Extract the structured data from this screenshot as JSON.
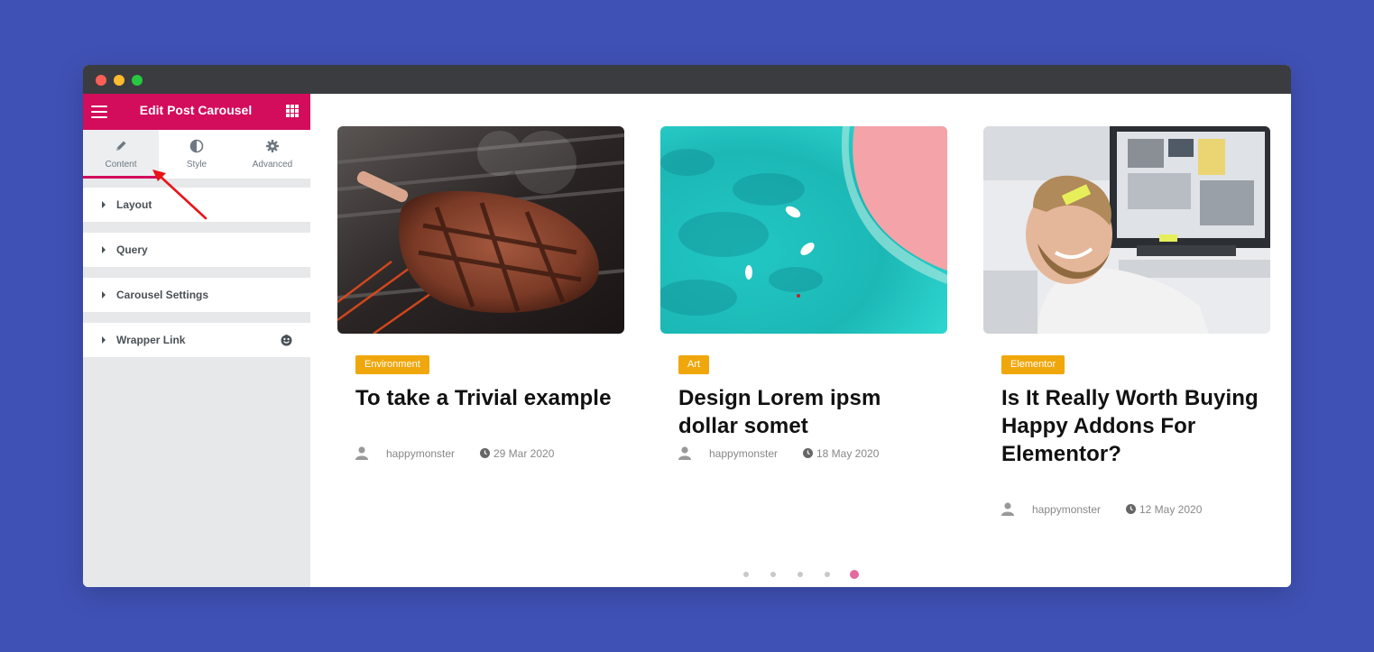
{
  "panel": {
    "title": "Edit Post Carousel",
    "header_color": "#d30c5c",
    "tabs": [
      {
        "label": "Content",
        "icon": "pencil-icon",
        "active": true
      },
      {
        "label": "Style",
        "icon": "contrast-icon",
        "active": false
      },
      {
        "label": "Advanced",
        "icon": "gear-icon",
        "active": false
      }
    ],
    "sections": [
      {
        "label": "Layout"
      },
      {
        "label": "Query"
      },
      {
        "label": "Carousel Settings"
      },
      {
        "label": "Wrapper Link",
        "icon": "happy-addons-icon"
      }
    ]
  },
  "posts": [
    {
      "category": "Environment",
      "title": "To take a Trivial example",
      "author": "happymonster",
      "date": "29 Mar 2020",
      "image": "grilled-steak-photo"
    },
    {
      "category": "Art",
      "title": "Design Lorem ipsm dollar somet",
      "author": "happymonster",
      "date": "18 May 2020",
      "image": "turquoise-sea-boats-photo"
    },
    {
      "category": "Elementor",
      "title": "Is It Really Worth Buying Happy Addons For Elementor?",
      "author": "happymonster",
      "date": "12 May 2020",
      "image": "smiling-bearded-man-photo"
    }
  ],
  "pagination": {
    "count": 5,
    "active_index": 4
  },
  "colors": {
    "background": "#3f51b5",
    "badge": "#f0a70c",
    "active_dot": "#e26a9e"
  }
}
